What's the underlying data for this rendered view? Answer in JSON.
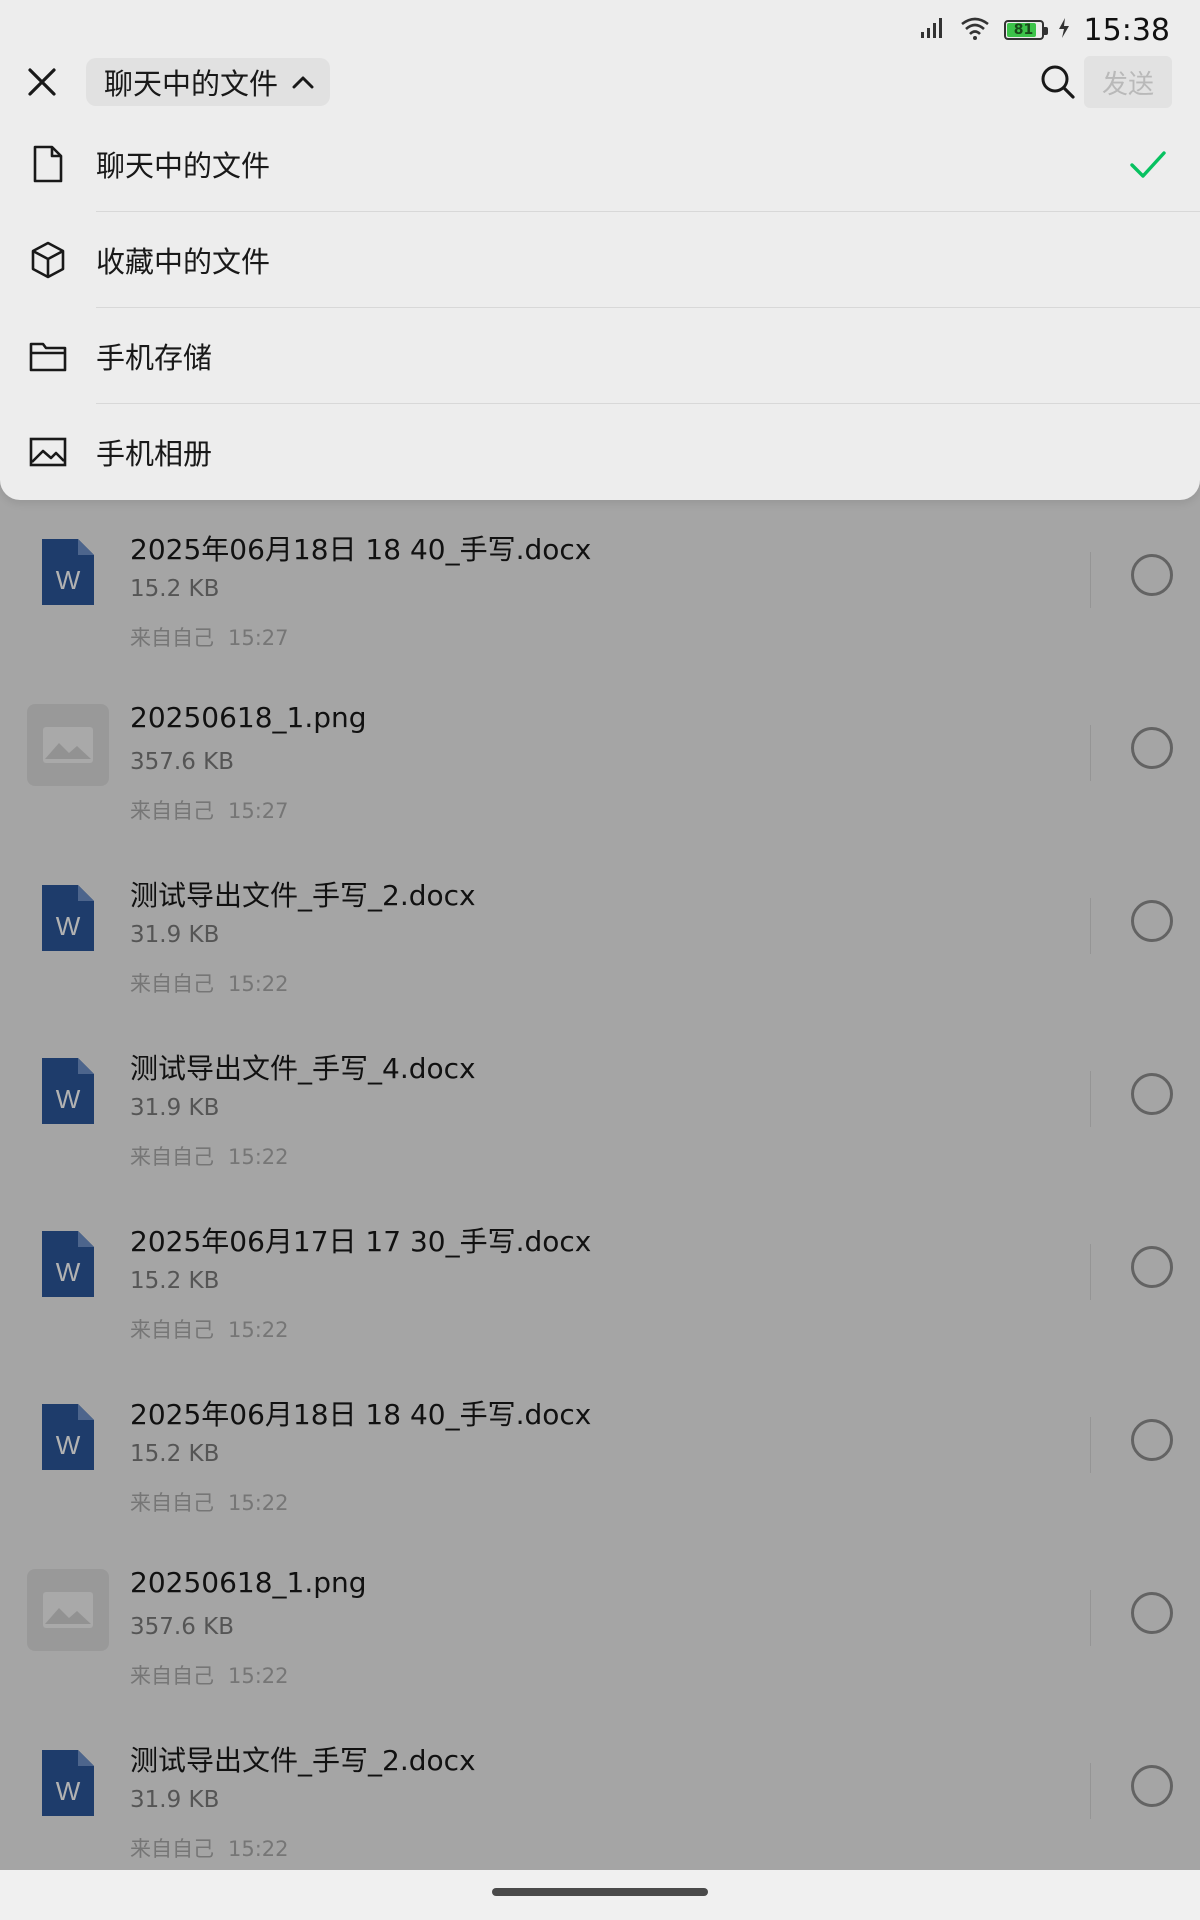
{
  "status_bar": {
    "time": "15:38",
    "battery_level": "81",
    "battery_fill_fraction": 0.81,
    "battery_color": "#3cc34a",
    "icons": [
      "signal-icon",
      "wifi-icon",
      "battery-icon",
      "charging-icon"
    ]
  },
  "header": {
    "close_icon": "close-icon",
    "source_selector_label": "聊天中的文件",
    "source_selector_icon": "chevron-up-icon",
    "search_icon": "search-icon",
    "send_label": "发送"
  },
  "source_menu": {
    "items": [
      {
        "label": "聊天中的文件",
        "icon": "file-icon",
        "selected": true
      },
      {
        "label": "收藏中的文件",
        "icon": "cube-icon",
        "selected": false
      },
      {
        "label": "手机存储",
        "icon": "folder-icon",
        "selected": false
      },
      {
        "label": "手机相册",
        "icon": "image-icon",
        "selected": false
      }
    ],
    "check_color": "#07c160"
  },
  "files": [
    {
      "name": "2025年06月18日 18 40_手写.docx",
      "size": "15.2 KB",
      "source": "来自自己",
      "time": "15:27",
      "type": "word"
    },
    {
      "name": "20250618_1.png",
      "size": "357.6 KB",
      "source": "来自自己",
      "time": "15:27",
      "type": "image"
    },
    {
      "name": "测试导出文件_手写_2.docx",
      "size": "31.9 KB",
      "source": "来自自己",
      "time": "15:22",
      "type": "word"
    },
    {
      "name": "测试导出文件_手写_4.docx",
      "size": "31.9 KB",
      "source": "来自自己",
      "time": "15:22",
      "type": "word"
    },
    {
      "name": "2025年06月17日 17 30_手写.docx",
      "size": "15.2 KB",
      "source": "来自自己",
      "time": "15:22",
      "type": "word"
    },
    {
      "name": "2025年06月18日 18 40_手写.docx",
      "size": "15.2 KB",
      "source": "来自自己",
      "time": "15:22",
      "type": "word"
    },
    {
      "name": "20250618_1.png",
      "size": "357.6 KB",
      "source": "来自自己",
      "time": "15:22",
      "type": "image"
    },
    {
      "name": "测试导出文件_手写_2.docx",
      "size": "31.9 KB",
      "source": "来自自己",
      "time": "15:22",
      "type": "word"
    }
  ],
  "colors": {
    "word_icon": "#2b579a",
    "background": "#ededed"
  }
}
